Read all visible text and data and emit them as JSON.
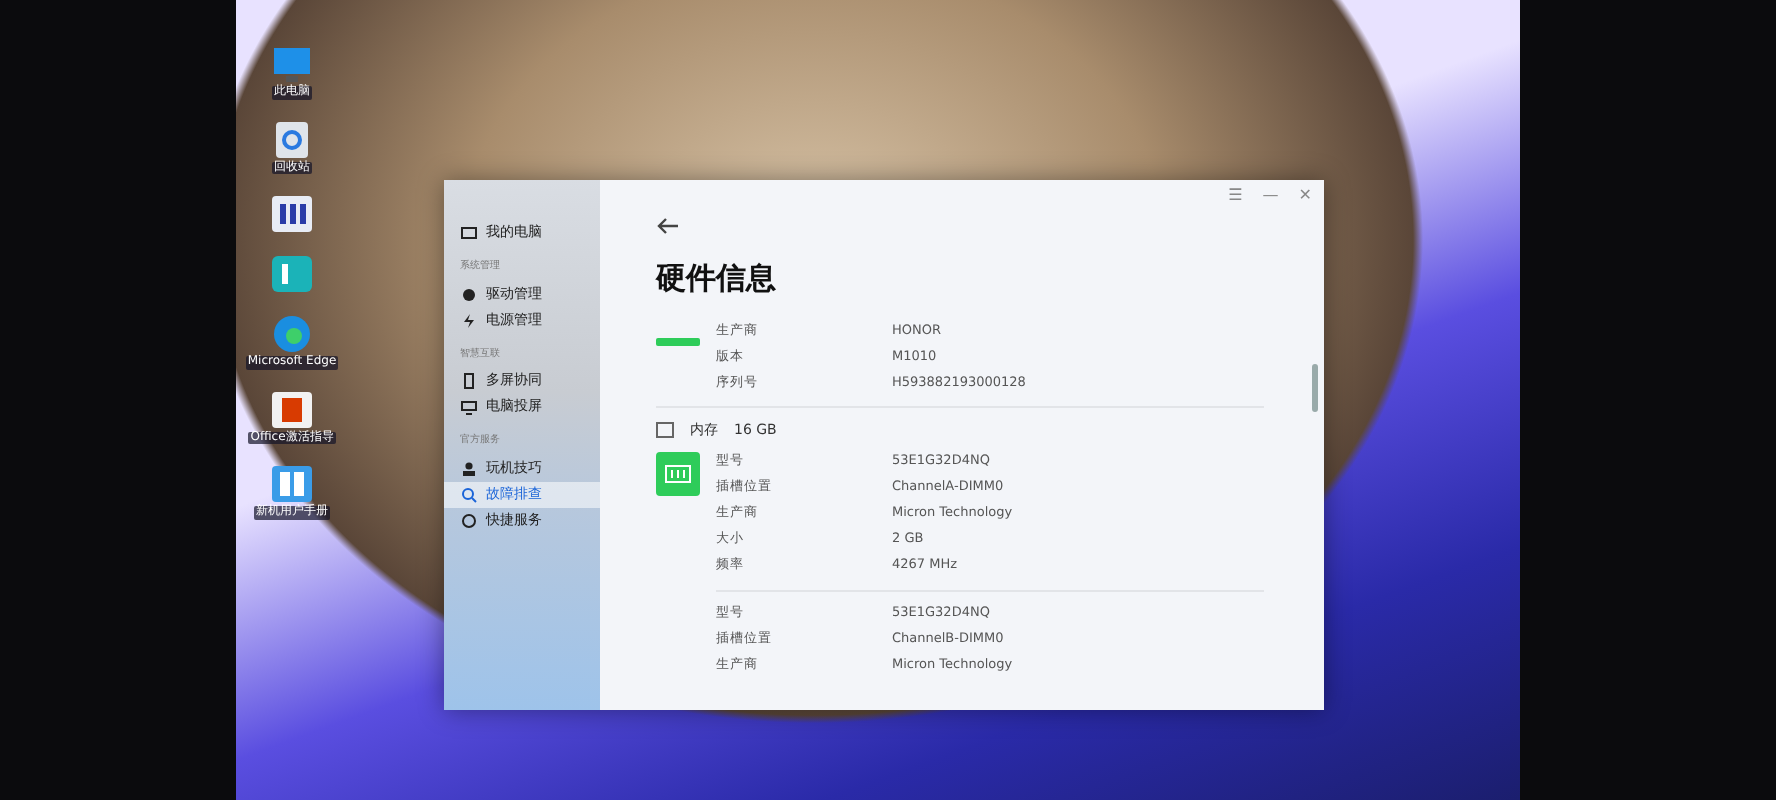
{
  "desktop_icons": [
    {
      "kind": "monitor",
      "label": "此电脑"
    },
    {
      "kind": "recycle",
      "label": "回收站"
    },
    {
      "kind": "app-m"
    },
    {
      "kind": "app-b"
    },
    {
      "kind": "edge",
      "label": "Microsoft Edge"
    },
    {
      "kind": "office",
      "label": "Office激活指导"
    },
    {
      "kind": "book",
      "label": "新机用户手册"
    }
  ],
  "window": {
    "controls": [
      "☰",
      "—",
      "✕"
    ],
    "title": "硬件信息",
    "sidebar": [
      {
        "kind": "item",
        "label": "我的电脑",
        "selected": false
      },
      {
        "kind": "header",
        "label": "系统管理"
      },
      {
        "kind": "item",
        "label": "驱动管理",
        "selected": false
      },
      {
        "kind": "item",
        "label": "电源管理",
        "selected": false
      },
      {
        "kind": "header",
        "label": "智慧互联"
      },
      {
        "kind": "item",
        "label": "多屏协同",
        "selected": false
      },
      {
        "kind": "item",
        "label": "电脑投屏",
        "selected": false
      },
      {
        "kind": "header",
        "label": "官方服务"
      },
      {
        "kind": "item",
        "label": "玩机技巧",
        "selected": false
      },
      {
        "kind": "item",
        "label": "故障排查",
        "selected": true
      },
      {
        "kind": "item",
        "label": "快捷服务",
        "selected": false
      }
    ],
    "sections": [
      {
        "groups": [
          {
            "rows": [
              [
                "生产商",
                "HONOR"
              ],
              [
                "版本",
                "M1010"
              ],
              [
                "序列号",
                "H593882193000128"
              ]
            ]
          }
        ]
      },
      {
        "heading": {
          "label": "内存",
          "value": "16 GB"
        },
        "groups": [
          {
            "rows": [
              [
                "型号",
                "53E1G32D4NQ"
              ],
              [
                "插槽位置",
                "ChannelA-DIMM0"
              ],
              [
                "生产商",
                "Micron Technology"
              ],
              [
                "大小",
                "2 GB"
              ],
              [
                "频率",
                "4267 MHz"
              ]
            ]
          },
          {
            "rows": [
              [
                "型号",
                "53E1G32D4NQ"
              ],
              [
                "插槽位置",
                "ChannelB-DIMM0"
              ],
              [
                "生产商",
                "Micron Technology"
              ]
            ]
          }
        ]
      }
    ]
  }
}
